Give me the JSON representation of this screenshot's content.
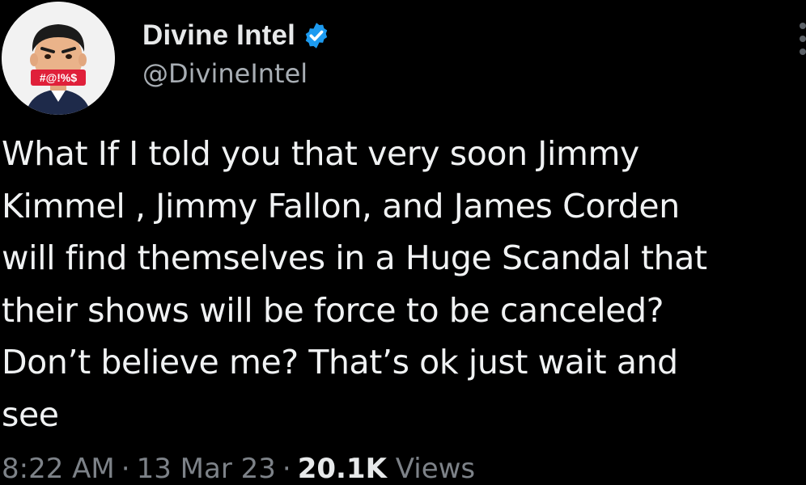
{
  "author": {
    "display_name": "Divine Intel",
    "handle": "@DivineIntel",
    "verified": true,
    "avatar_sign_text": "#@!%$"
  },
  "tweet": {
    "text": "What If I told you that very soon Jimmy\nKimmel , Jimmy Fallon, and James Corden\nwill find themselves in a Huge Scandal that\ntheir shows will be force to be canceled?\nDon’t believe me? That’s ok just wait and\nsee"
  },
  "meta": {
    "time": "8:22 AM",
    "date": "13 Mar 23",
    "separator": "·",
    "views_count": "20.1K",
    "views_label": "Views"
  },
  "colors": {
    "background": "#000000",
    "text": "#e7e9ea",
    "secondary_text": "#7d8288",
    "verified_badge": "#1d9bf0"
  },
  "icons": {
    "verified": "verified-badge-icon",
    "more": "more-options-icon"
  }
}
